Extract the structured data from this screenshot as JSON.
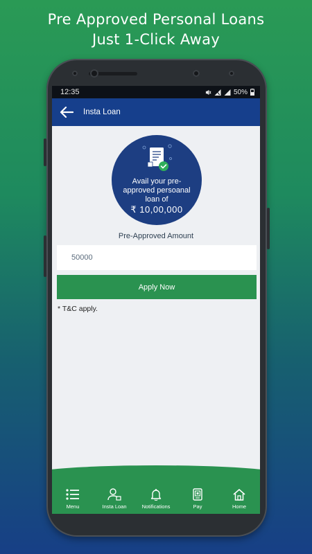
{
  "headline": {
    "line1": "Pre Approved Personal Loans",
    "line2": "Just 1-Click Away"
  },
  "status_bar": {
    "time": "12:35",
    "battery": "50%"
  },
  "app_bar": {
    "title": "Insta Loan"
  },
  "promo": {
    "line1": "Avail your pre-",
    "line2": "approved persoanal",
    "line3": "loan of",
    "amount": "₹ 10,00,000"
  },
  "form": {
    "label": "Pre-Approved Amount",
    "amount_value": "50000",
    "apply_label": "Apply Now",
    "tnc": "* T&C apply."
  },
  "bottom_nav": {
    "items": [
      {
        "label": "Menu",
        "icon": "menu-icon"
      },
      {
        "label": "Insta Loan",
        "icon": "user-loan-icon"
      },
      {
        "label": "Notifications",
        "icon": "bell-icon"
      },
      {
        "label": "Pay",
        "icon": "pay-icon"
      },
      {
        "label": "Home",
        "icon": "home-icon"
      }
    ]
  },
  "colors": {
    "app_bar": "#163f8c",
    "accent_green": "#2a9250",
    "promo_circle": "#1d3e82",
    "screen_bg": "#eef0f3"
  }
}
